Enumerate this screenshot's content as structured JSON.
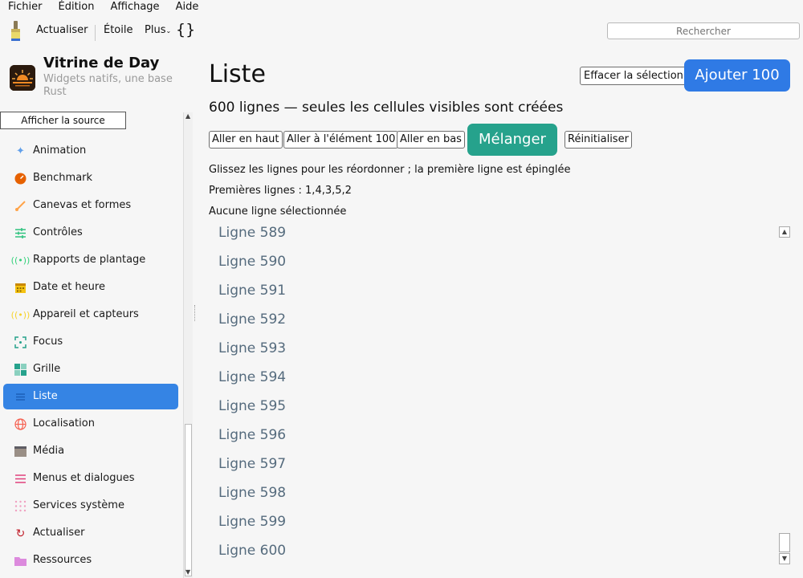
{
  "menu": [
    "Fichier",
    "Édition",
    "Affichage",
    "Aide"
  ],
  "toolbar": {
    "refresh": "Actualiser",
    "star": "Étoile",
    "more": "Plus",
    "braces": "{}",
    "search_placeholder": "Rechercher"
  },
  "app": {
    "title": "Vitrine de Day",
    "subtitle": "Widgets natifs, une base Rust",
    "source_button": "Afficher la source"
  },
  "sidebar": {
    "items": [
      {
        "label": "Animation",
        "icon": "sparkle-icon",
        "color": "#62a0ea"
      },
      {
        "label": "Benchmark",
        "icon": "gauge-icon",
        "color": "#e66100"
      },
      {
        "label": "Canevas et formes",
        "icon": "brush-icon",
        "color": "#ffa348"
      },
      {
        "label": "Contrôles",
        "icon": "sliders-icon",
        "color": "#2ec27e"
      },
      {
        "label": "Rapports de plantage",
        "icon": "broadcast-icon",
        "color": "#33d17a"
      },
      {
        "label": "Date et heure",
        "icon": "calendar-icon",
        "color": "#c88800"
      },
      {
        "label": "Appareil et capteurs",
        "icon": "sensor-icon",
        "color": "#f6d32d"
      },
      {
        "label": "Focus",
        "icon": "focus-icon",
        "color": "#26a28c"
      },
      {
        "label": "Grille",
        "icon": "grid-icon",
        "color": "#26a28c"
      },
      {
        "label": "Liste",
        "icon": "list-icon",
        "color": "#ffffff"
      },
      {
        "label": "Localisation",
        "icon": "globe-icon",
        "color": "#f66151"
      },
      {
        "label": "Média",
        "icon": "clapper-icon",
        "color": "#9a8f86"
      },
      {
        "label": "Menus et dialogues",
        "icon": "menu-icon",
        "color": "#e0407b"
      },
      {
        "label": "Services système",
        "icon": "dots-grid-icon",
        "color": "#f0a0c0"
      },
      {
        "label": "Actualiser",
        "icon": "refresh-icon",
        "color": "#c01c28"
      },
      {
        "label": "Ressources",
        "icon": "folder-icon",
        "color": "#dc8add"
      }
    ],
    "active": "Liste"
  },
  "main": {
    "title": "Liste",
    "clear_button": "Effacer la sélection",
    "add_button": "Ajouter 100",
    "subtitle": "600 lignes — seules les cellules visibles sont créées",
    "buttons": {
      "top": "Aller en haut",
      "item100": "Aller à l'élément 100",
      "bottom": "Aller en bas",
      "shuffle": "Mélanger",
      "reset": "Réinitialiser"
    },
    "hint": "Glissez les lignes pour les réordonner ; la première ligne est épinglée",
    "first_rows": "Premières lignes : 1,4,3,5,2",
    "selection": "Aucune ligne sélectionnée",
    "rows": [
      "Ligne 589",
      "Ligne 590",
      "Ligne 591",
      "Ligne 592",
      "Ligne 593",
      "Ligne 594",
      "Ligne 595",
      "Ligne 596",
      "Ligne 597",
      "Ligne 598",
      "Ligne 599",
      "Ligne 600"
    ]
  },
  "colors": {
    "accent_blue": "#2f7ae5",
    "accent_teal": "#26a28c",
    "active_item": "#3584e4",
    "list_text": "#556b7d"
  }
}
